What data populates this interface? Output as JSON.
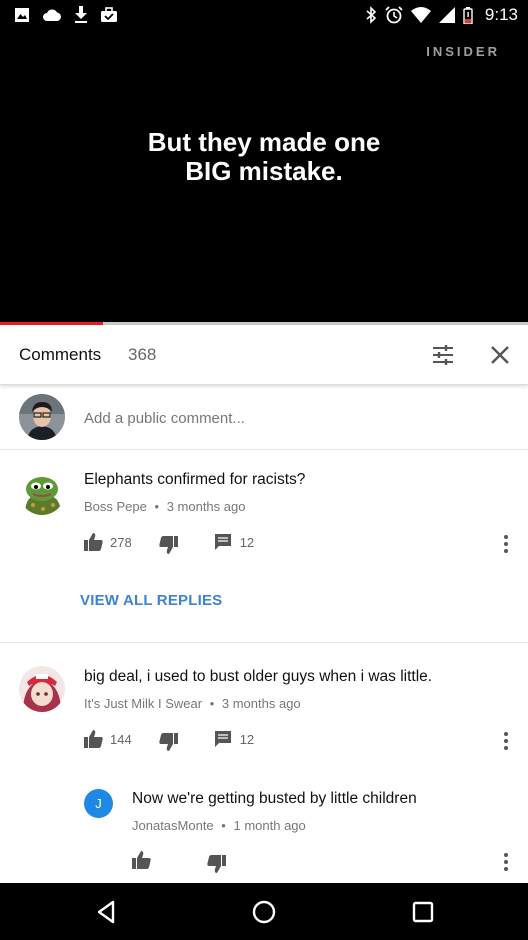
{
  "status_bar": {
    "time": "9:13",
    "left_icons": [
      "image-icon",
      "cloud-icon",
      "download-icon",
      "briefcase-icon"
    ],
    "right_icons": [
      "bluetooth-icon",
      "alarm-icon",
      "wifi-icon",
      "signal-icon",
      "battery-icon"
    ]
  },
  "video": {
    "brand": "INSIDER",
    "caption_line1": "But they made one",
    "caption_line2": "BIG mistake.",
    "progress_fraction": 0.195,
    "progress_color": "#e62117"
  },
  "comments_header": {
    "title": "Comments",
    "count": "368"
  },
  "add_comment": {
    "placeholder": "Add a public comment..."
  },
  "comments": [
    {
      "text": "Elephants confirmed for racists?",
      "author": "Boss Pepe",
      "time": "3 months ago",
      "likes": "278",
      "replies": "12"
    },
    {
      "text": "big deal, i used to bust older guys when i was little.",
      "author": "It's Just Milk I Swear",
      "time": "3 months ago",
      "likes": "144",
      "replies": "12"
    }
  ],
  "view_all_replies": "VIEW ALL REPLIES",
  "reply": {
    "avatar_letter": "J",
    "avatar_color": "#1e88e5",
    "text": "Now we're getting busted by little children",
    "author": "JonatasMonte",
    "time": "1 month ago"
  },
  "separator": "•",
  "colors": {
    "link": "#3d82d6",
    "accent": "#e62117"
  }
}
